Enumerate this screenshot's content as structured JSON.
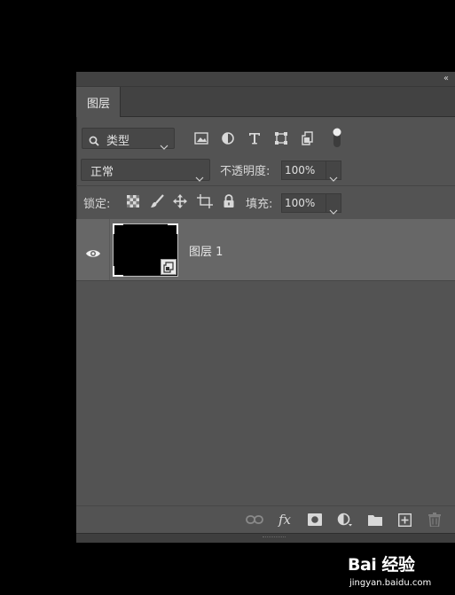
{
  "panel": {
    "collapse_glyph": "‹‹",
    "tab_label": "图层"
  },
  "filter": {
    "kind_label": "类型",
    "icons": [
      "image-filter-icon",
      "adjustment-filter-icon",
      "type-filter-icon",
      "shape-filter-icon",
      "smart-object-filter-icon"
    ],
    "toggle_state": "on"
  },
  "blend": {
    "mode_label": "正常",
    "opacity_label": "不透明度:",
    "opacity_value": "100%"
  },
  "lock": {
    "label": "锁定:",
    "icons": [
      "lock-transparent-pixels-icon",
      "lock-image-pixels-icon",
      "lock-position-icon",
      "lock-artboard-icon",
      "lock-all-icon"
    ],
    "fill_label": "填充:",
    "fill_value": "100%"
  },
  "layers": [
    {
      "name": "图层 1",
      "visible": true,
      "type": "smart-object",
      "thumbnail_color": "#000000"
    }
  ],
  "bottom_toolbar": {
    "icons": [
      "link-layers-icon",
      "fx-icon",
      "layer-mask-icon",
      "adjustment-layer-icon",
      "group-folder-icon",
      "new-layer-icon",
      "delete-layer-icon"
    ],
    "fx_label": "fx"
  },
  "watermark": {
    "brand": "Bai 经验",
    "url": "jingyan.baidu.com"
  },
  "colors": {
    "background": "#000000",
    "panel": "#535353",
    "selected_layer": "#676767",
    "text": "#e0e0e0"
  }
}
